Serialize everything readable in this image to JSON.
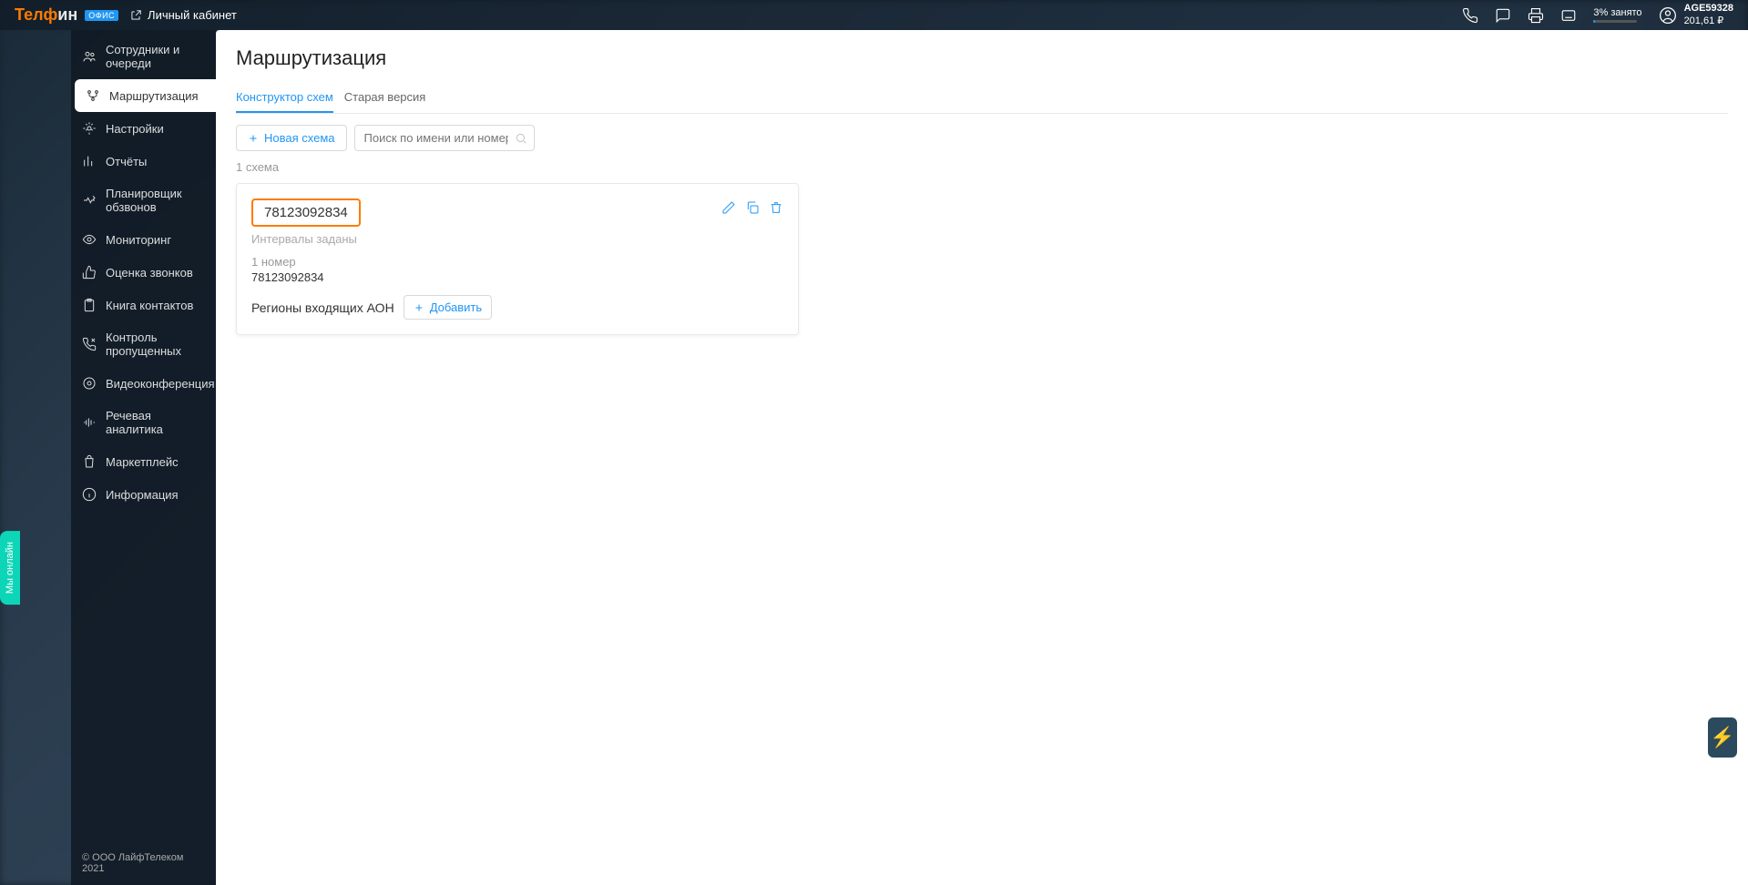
{
  "header": {
    "logo_main": "Телфин",
    "logo_badge": "ОФИС",
    "cabinet_label": "Личный кабинет",
    "storage_label": "3% занято",
    "account_id": "AGE59328",
    "account_balance": "201,61 ₽"
  },
  "sidebar": {
    "items": [
      {
        "label": "Сотрудники и очереди"
      },
      {
        "label": "Маршрутизация"
      },
      {
        "label": "Настройки"
      },
      {
        "label": "Отчёты"
      },
      {
        "label": "Планировщик обзвонов"
      },
      {
        "label": "Мониторинг"
      },
      {
        "label": "Оценка звонков"
      },
      {
        "label": "Книга контактов"
      },
      {
        "label": "Контроль пропущенных"
      },
      {
        "label": "Видеоконференция"
      },
      {
        "label": "Речевая аналитика"
      },
      {
        "label": "Маркетплейс"
      },
      {
        "label": "Информация"
      }
    ],
    "copyright": "© ООО ЛайфТелеком 2021"
  },
  "page": {
    "title": "Маршрутизация",
    "tabs": [
      {
        "label": "Конструктор схем"
      },
      {
        "label": "Старая версия"
      }
    ],
    "new_scheme_label": "Новая схема",
    "search_placeholder": "Поиск по имени или номеру",
    "count_label": "1 схема"
  },
  "card": {
    "title": "78123092834",
    "subtitle": "Интервалы заданы",
    "number_count": "1 номер",
    "number": "78123092834",
    "regions_label": "Регионы входящих АОН",
    "add_label": "Добавить"
  },
  "chat": {
    "label": "Мы онлайн"
  }
}
